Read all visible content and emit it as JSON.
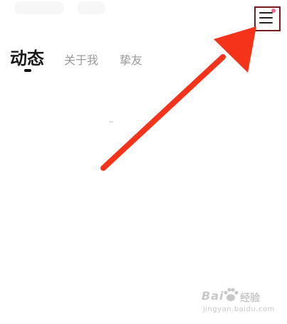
{
  "tabs": [
    {
      "label": "动态",
      "active": true
    },
    {
      "label": "关于我",
      "active": false
    },
    {
      "label": "挚友",
      "active": false
    }
  ],
  "menu": {
    "icon": "hamburger-menu-icon",
    "notification_dot_color": "#f06a8c",
    "highlight_border_color": "#7a1a1f"
  },
  "annotation": {
    "arrow_color": "#f4331a"
  },
  "watermark": {
    "left_text": "Bai",
    "right_text": "经验",
    "url": "jingyan.baidu.com"
  }
}
